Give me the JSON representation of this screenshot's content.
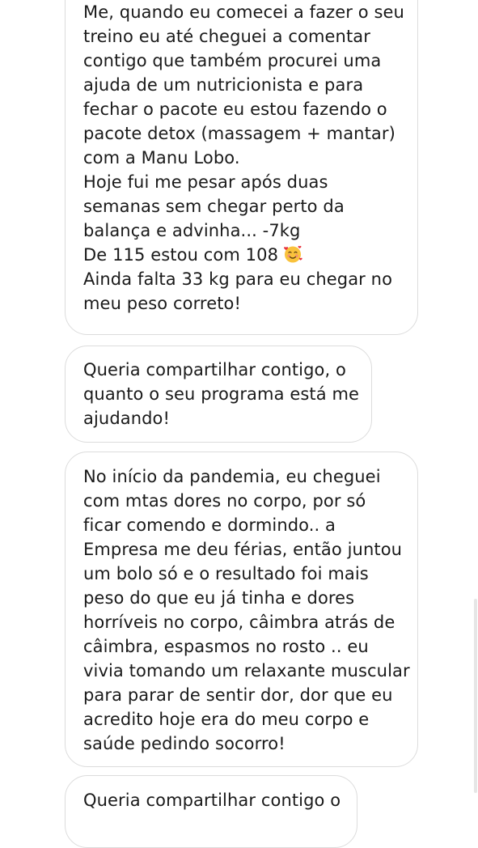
{
  "conversation": {
    "messages": [
      {
        "lines": [
          "Me, quando eu comecei a fazer o seu",
          "treino eu até cheguei a comentar",
          "contigo que também procurei uma",
          "ajuda de um nutricionista e para",
          "fechar o pacote eu estou fazendo o",
          "pacote detox (massagem + mantar)",
          "com a Manu Lobo.",
          "Hoje fui me pesar após duas",
          "semanas sem chegar perto da",
          "balança e advinha... -7kg",
          "De 115 estou com 108",
          "Ainda falta 33 kg para eu chegar no",
          "meu peso correto!"
        ],
        "emoji": "smiling-face-with-hearts-emoji"
      },
      {
        "lines": [
          "Queria compartilhar contigo, o",
          "quanto o seu programa está me",
          "ajudando!"
        ]
      },
      {
        "lines": [
          "No início da pandemia, eu cheguei",
          "com mtas dores no corpo, por só",
          "ficar comendo e dormindo.. a",
          "Empresa me deu férias, então juntou",
          "um bolo só e o resultado foi mais",
          "peso do que eu já tinha e dores",
          "horríveis no corpo, câimbra atrás de",
          "câimbra, espasmos no rosto .. eu",
          "vivia tomando um relaxante muscular",
          "para parar de sentir dor, dor que eu",
          "acredito hoje era do meu corpo e",
          "saúde pedindo socorro!"
        ]
      },
      {
        "lines": [
          "Queria compartilhar contigo o"
        ]
      }
    ]
  },
  "colors": {
    "bubble_border": "#dcdcdc",
    "text": "#1a1a1a",
    "background": "#ffffff"
  }
}
